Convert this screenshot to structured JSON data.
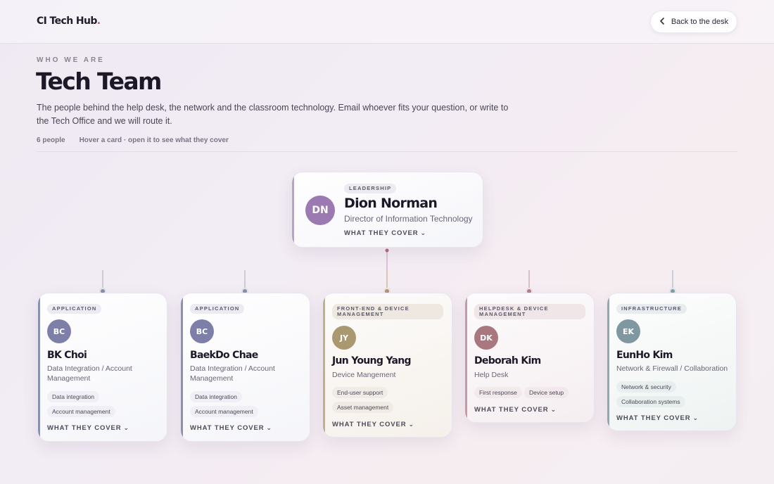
{
  "brand": {
    "name": "CI Tech Hub",
    "dot": "."
  },
  "header": {
    "back_label": "Back to the desk"
  },
  "intro": {
    "eyebrow": "WHO WE ARE",
    "title": "Tech Team",
    "description": "The people behind the help desk, the network and the classroom technology. Email whoever fits your question, or write to the Tech Office and we will route it.",
    "count": "6 people",
    "hint": "Hover a card · open it to see what they cover"
  },
  "leader": {
    "badge": "LEADERSHIP",
    "initials": "DN",
    "name": "Dion Norman",
    "role": "Director of Information Technology",
    "cover_label": "WHAT THEY COVER",
    "avatar_color": "#9a7ab0"
  },
  "members": [
    {
      "badge": "APPLICATION",
      "initials": "BC",
      "name": "BK Choi",
      "role_line1": "Data Integration / Account",
      "role_line2": "Management",
      "chips": [
        "Data integration",
        "Account management"
      ],
      "cover_label": "WHAT THEY COVER",
      "avatar_color": "#7e7fa8",
      "accent": "#8a90b0"
    },
    {
      "badge": "APPLICATION",
      "initials": "BC",
      "name": "BaekDo Chae",
      "role_line1": "Data Integration / Account",
      "role_line2": "Management",
      "chips": [
        "Data integration",
        "Account management"
      ],
      "cover_label": "WHAT THEY COVER",
      "avatar_color": "#7e7fa8",
      "accent": "#8a90b0"
    },
    {
      "badge_line1": "FRONT-END & DEVICE",
      "badge_line2": "MANAGEMENT",
      "initials": "JY",
      "name": "Jun Young Yang",
      "role_line1": "Device Mangement",
      "chips": [
        "End-user support",
        "Asset management"
      ],
      "cover_label": "WHAT THEY COVER",
      "avatar_color": "#a99870",
      "accent": "#c6ad88"
    },
    {
      "badge_line1": "HELPDESK & DEVICE",
      "badge_line2": "MANAGEMENT",
      "initials": "DK",
      "name": "Deborah Kim",
      "role_line1": "Help Desk",
      "chips": [
        "First response",
        "Device setup"
      ],
      "cover_label": "WHAT THEY COVER",
      "avatar_color": "#a8787e",
      "accent": "#c69aa2"
    },
    {
      "badge": "INFRASTRUCTURE",
      "initials": "EK",
      "name": "EunHo Kim",
      "role_line1": "Network & Firewall / Collaboration",
      "chips": [
        "Network & security",
        "Collaboration systems"
      ],
      "cover_label": "WHAT THEY COVER",
      "avatar_color": "#7e97a0",
      "accent": "#8eaab0"
    }
  ]
}
